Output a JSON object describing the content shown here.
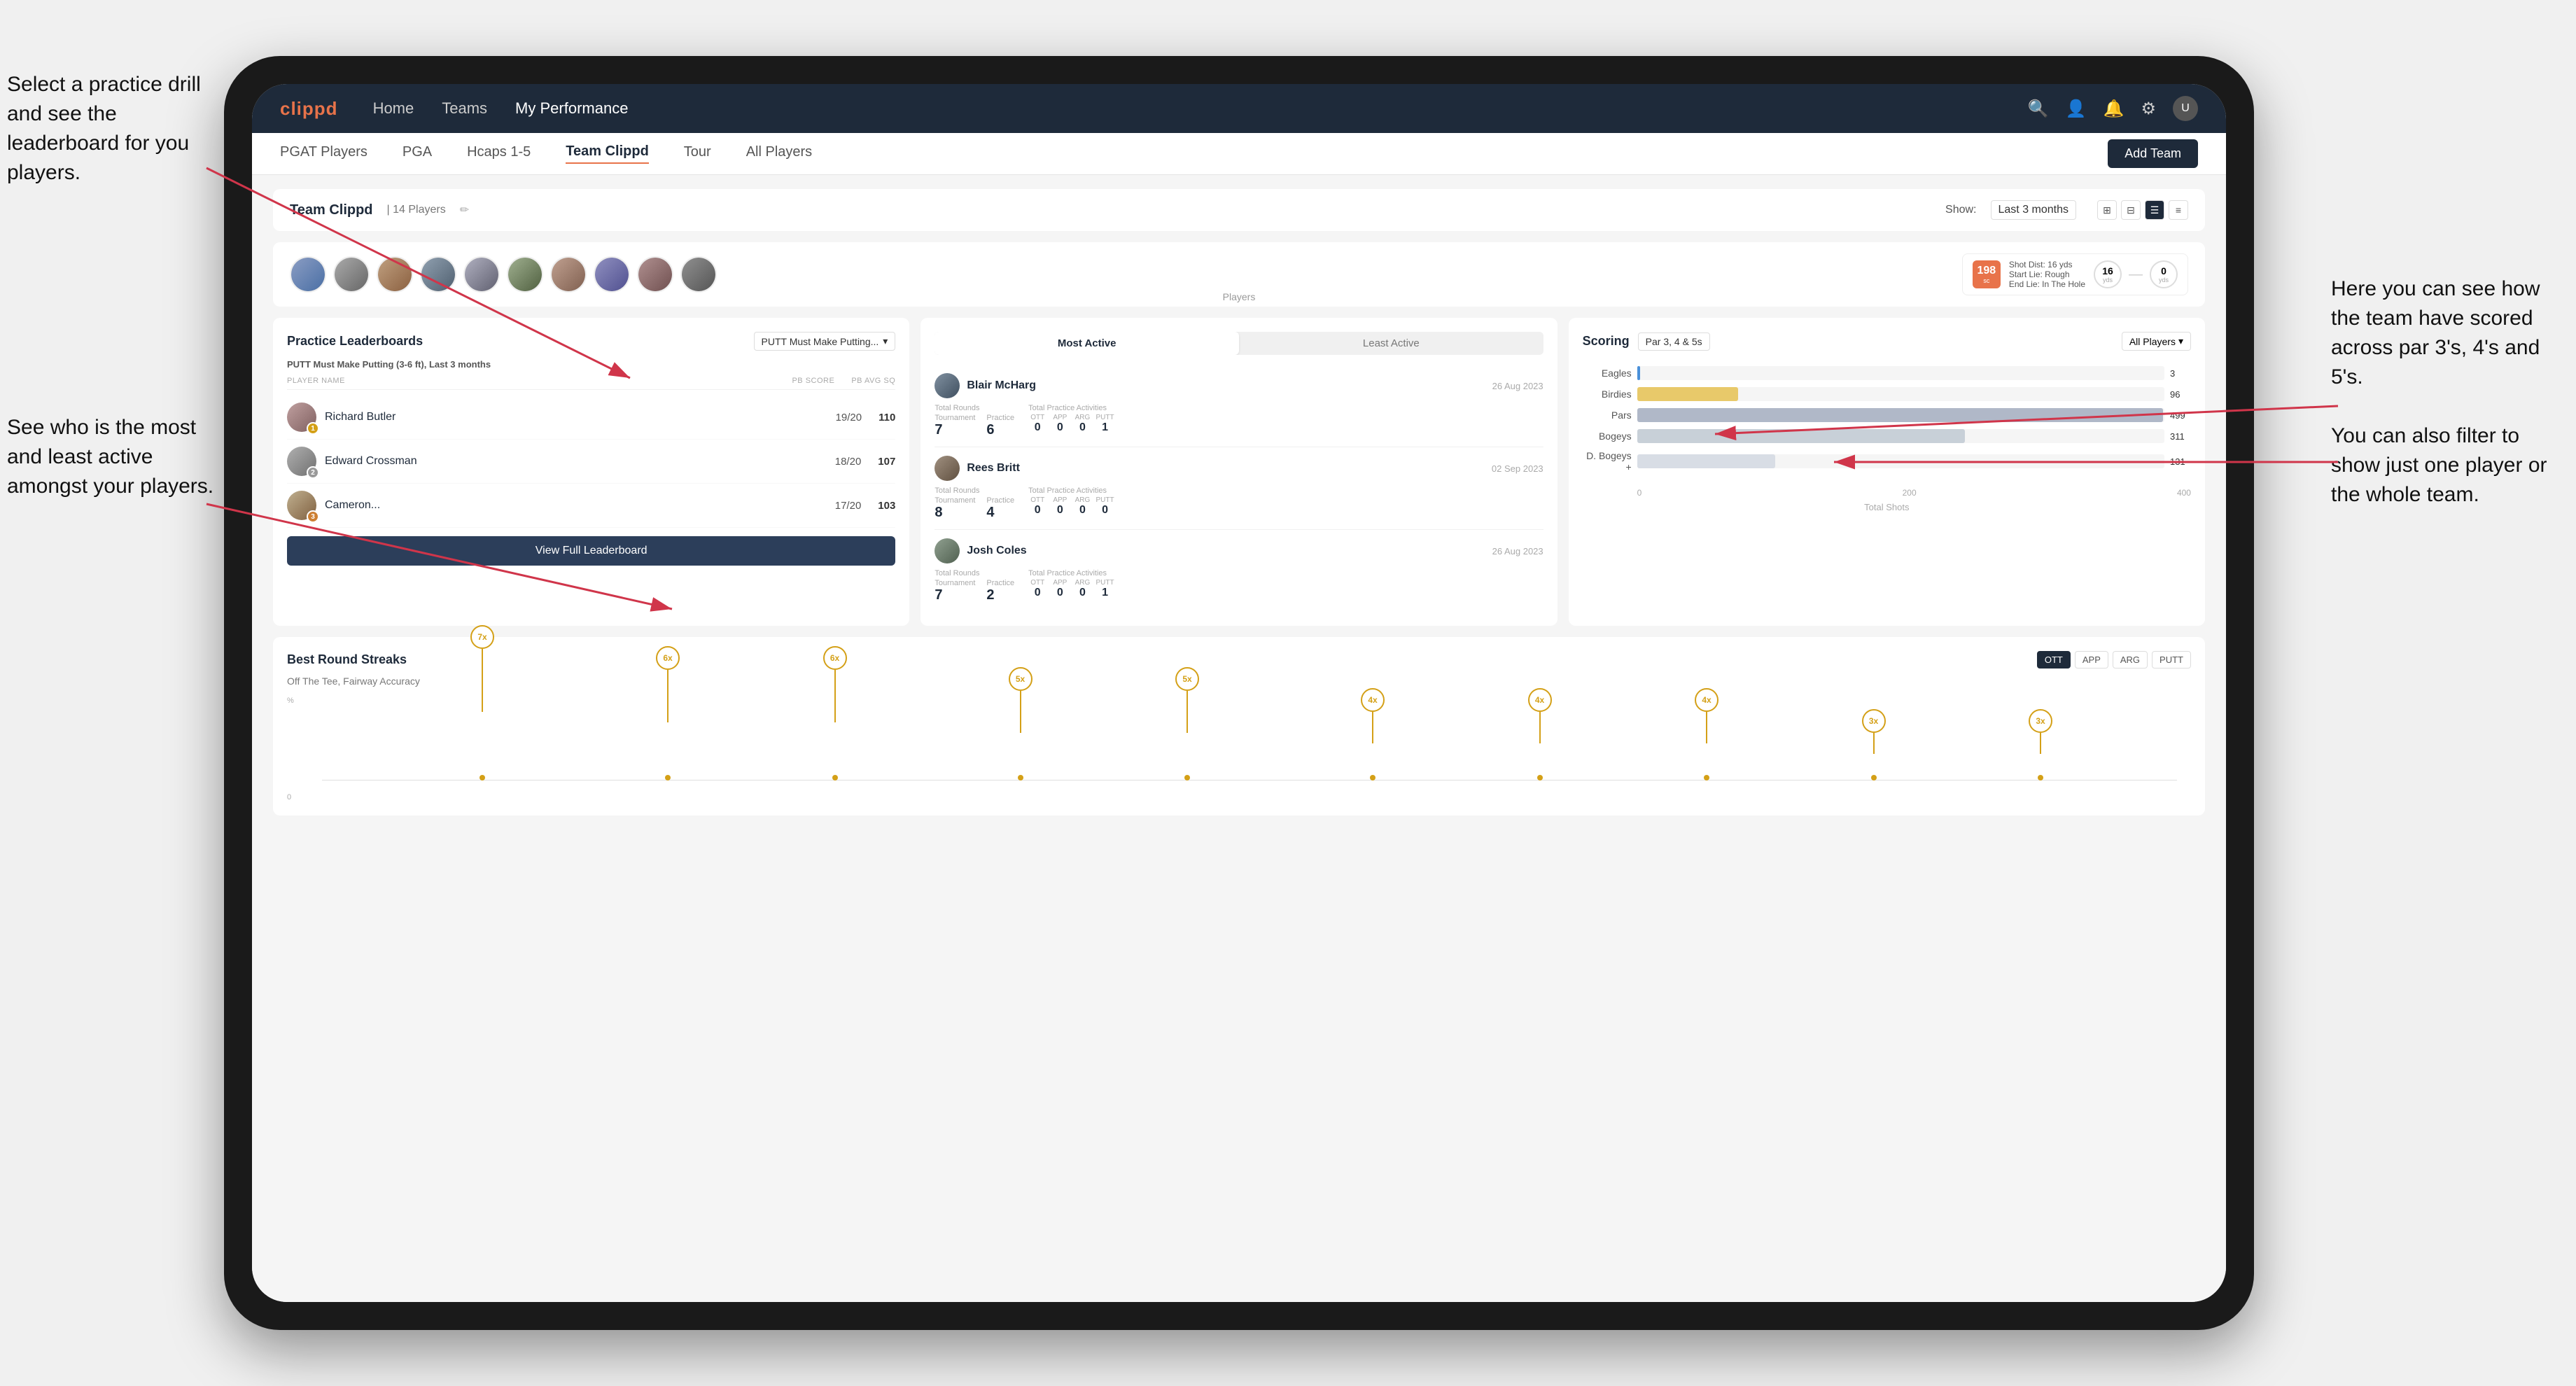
{
  "app": {
    "name": "clippd"
  },
  "nav": {
    "logo": "clippd",
    "links": [
      "Home",
      "Teams",
      "My Performance"
    ],
    "active_link": "Teams"
  },
  "sub_nav": {
    "links": [
      "PGAT Players",
      "PGA",
      "Hcaps 1-5",
      "Team Clippd",
      "Tour",
      "All Players"
    ],
    "active": "Team Clippd",
    "add_button": "Add Team"
  },
  "team_header": {
    "title": "Team Clippd",
    "player_count": "14 Players",
    "show_label": "Show:",
    "period": "Last 3 months",
    "view_options": [
      "grid-2",
      "grid-3",
      "list",
      "bars"
    ]
  },
  "players_row": {
    "label": "Players",
    "count": 10
  },
  "shot_card": {
    "shot_number": "198",
    "shot_label": "sc",
    "shot_dist": "Shot Dist: 16 yds",
    "start_lie": "Start Lie: Rough",
    "end_lie": "End Lie: In The Hole",
    "circle1_val": "16",
    "circle1_label": "yds",
    "circle2_val": "0",
    "circle2_label": "yds"
  },
  "practice_leaderboards": {
    "title": "Practice Leaderboards",
    "drill": "PUTT Must Make Putting...",
    "subtitle_drill": "PUTT Must Make Putting (3-6 ft),",
    "subtitle_period": "Last 3 months",
    "table_headers": [
      "PLAYER NAME",
      "PB SCORE",
      "PB AVG SQ"
    ],
    "players": [
      {
        "name": "Richard Butler",
        "score": "19/20",
        "avg": "110",
        "badge": "gold",
        "badge_num": "1"
      },
      {
        "name": "Edward Crossman",
        "score": "18/20",
        "avg": "107",
        "badge": "silver",
        "badge_num": "2"
      },
      {
        "name": "Cameron...",
        "score": "17/20",
        "avg": "103",
        "badge": "bronze",
        "badge_num": "3"
      }
    ],
    "view_button": "View Full Leaderboard"
  },
  "most_active": {
    "toggle_options": [
      "Most Active",
      "Least Active"
    ],
    "active_toggle": "Most Active",
    "players": [
      {
        "name": "Blair McHarg",
        "date": "26 Aug 2023",
        "total_rounds_label": "Total Rounds",
        "tournament_label": "Tournament",
        "practice_label": "Practice",
        "tournament_val": "7",
        "practice_val": "6",
        "total_practice_label": "Total Practice Activities",
        "ott_label": "OTT",
        "app_label": "APP",
        "arg_label": "ARG",
        "putt_label": "PUTT",
        "ott_val": "0",
        "app_val": "0",
        "arg_val": "0",
        "putt_val": "1"
      },
      {
        "name": "Rees Britt",
        "date": "02 Sep 2023",
        "tournament_val": "8",
        "practice_val": "4",
        "ott_val": "0",
        "app_val": "0",
        "arg_val": "0",
        "putt_val": "0"
      },
      {
        "name": "Josh Coles",
        "date": "26 Aug 2023",
        "tournament_val": "7",
        "practice_val": "2",
        "ott_val": "0",
        "app_val": "0",
        "arg_val": "0",
        "putt_val": "1"
      }
    ]
  },
  "scoring": {
    "title": "Scoring",
    "filter": "Par 3, 4 & 5s",
    "players_filter": "All Players",
    "bars": [
      {
        "label": "Eagles",
        "value": 3,
        "max": 500,
        "class": "eagles"
      },
      {
        "label": "Birdies",
        "value": 96,
        "max": 500,
        "class": "birdies"
      },
      {
        "label": "Pars",
        "value": 499,
        "max": 500,
        "class": "pars"
      },
      {
        "label": "Bogeys",
        "value": 311,
        "max": 500,
        "class": "bogeys"
      },
      {
        "label": "D. Bogeys +",
        "value": 131,
        "max": 500,
        "class": "dbogeys"
      }
    ],
    "x_axis": [
      "0",
      "200",
      "400"
    ],
    "x_label": "Total Shots"
  },
  "best_round_streaks": {
    "title": "Best Round Streaks",
    "subtitle": "Off The Tee, Fairway Accuracy",
    "filters": [
      "OTT",
      "APP",
      "ARG",
      "PUTT"
    ],
    "active_filter": "OTT",
    "bubbles": [
      {
        "x_pct": 8,
        "height": 90,
        "label": "7x"
      },
      {
        "x_pct": 18,
        "height": 75,
        "label": "6x"
      },
      {
        "x_pct": 27,
        "height": 75,
        "label": "6x"
      },
      {
        "x_pct": 37,
        "height": 60,
        "label": "5x"
      },
      {
        "x_pct": 46,
        "height": 60,
        "label": "5x"
      },
      {
        "x_pct": 56,
        "height": 45,
        "label": "4x"
      },
      {
        "x_pct": 65,
        "height": 45,
        "label": "4x"
      },
      {
        "x_pct": 74,
        "height": 45,
        "label": "4x"
      },
      {
        "x_pct": 83,
        "height": 30,
        "label": "3x"
      },
      {
        "x_pct": 92,
        "height": 30,
        "label": "3x"
      }
    ]
  },
  "annotations": {
    "top_left": "Select a practice drill and see the leaderboard for you players.",
    "bottom_left": "See who is the most and least active amongst your players.",
    "right": "Here you can see how the team have scored across par 3's, 4's and 5's.\n\nYou can also filter to show just one player or the whole team."
  }
}
